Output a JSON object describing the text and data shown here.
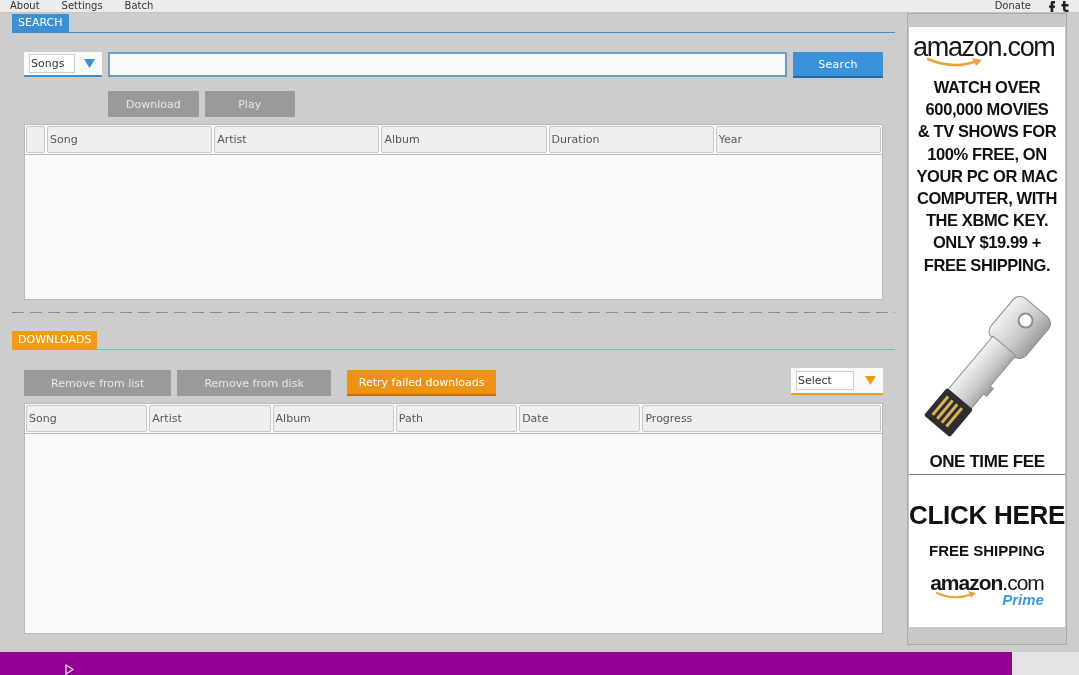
{
  "menu_bar": {
    "items": [
      {
        "label": "About"
      },
      {
        "label": "Settings"
      },
      {
        "label": "Batch"
      }
    ],
    "donate": "Donate"
  },
  "search_section": {
    "title": "SEARCH",
    "category": "Songs",
    "search_button": "Search",
    "actions": [
      {
        "label": "Download",
        "disabled": true
      },
      {
        "label": "Play",
        "disabled": true
      }
    ],
    "results_table": {
      "checkbox_column": true,
      "columns": [
        "Song",
        "Artist",
        "Album",
        "Duration",
        "Year"
      ]
    }
  },
  "downloads_section": {
    "title": "DOWNLOADS",
    "actions": [
      {
        "label": "Remove from list",
        "disabled": true
      },
      {
        "label": "Remove from disk",
        "disabled": true
      },
      {
        "label": "Retry failed downloads",
        "disabled": false
      }
    ],
    "filter": "Select",
    "table": {
      "columns": [
        "Song",
        "Artist",
        "Album",
        "Path",
        "Date",
        "Progress"
      ]
    }
  },
  "ad": {
    "logo": "amazon.com",
    "headline_lines": [
      "WATCH OVER",
      "600,000 MOVIES",
      "& TV SHOWS FOR",
      "100% FREE, ON",
      "YOUR PC OR MAC",
      "COMPUTER, WITH",
      "THE XBMC KEY.",
      "ONLY $19.99 +",
      "FREE SHIPPING."
    ],
    "caption": "ONE TIME FEE",
    "cta": "CLICK HERE",
    "shipping": "FREE SHIPPING",
    "prime_logo": "**amazon**.com",
    "prime_label": "Prime"
  }
}
